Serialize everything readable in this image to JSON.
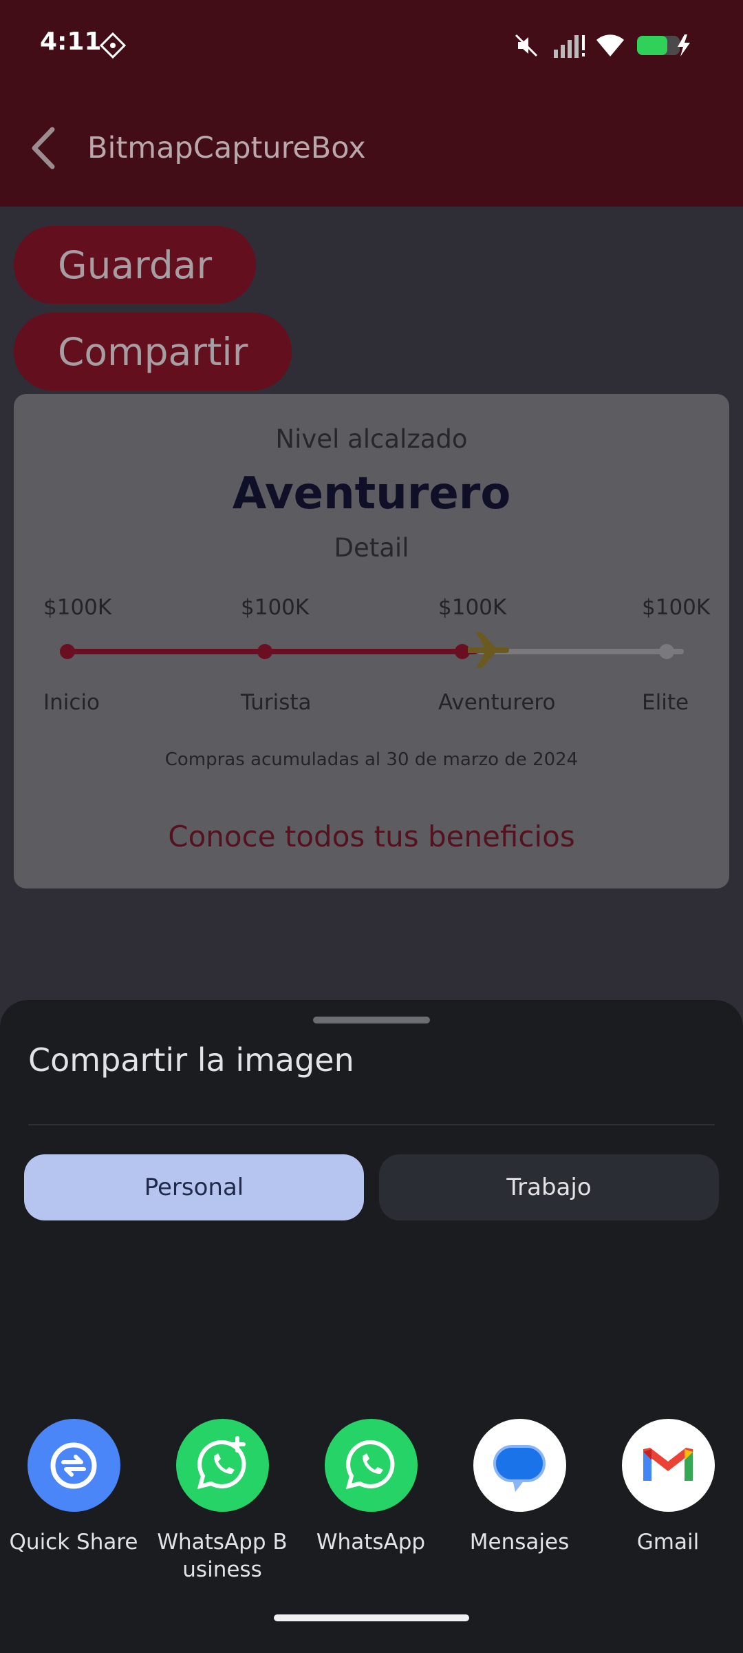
{
  "status_bar": {
    "time": "4:11",
    "icons": [
      "location-diamond-icon",
      "mute-icon",
      "signal-icon",
      "wifi-icon",
      "battery-charging-icon"
    ]
  },
  "app_bar": {
    "back_icon": "back-arrow-icon",
    "title": "BitmapCaptureBox"
  },
  "actions": {
    "guardar": "Guardar",
    "compartir": "Compartir"
  },
  "card": {
    "nivel_label": "Nivel alcalzado",
    "level_name": "Aventurero",
    "detail": "Detail",
    "progress": {
      "amounts": [
        "$100K",
        "$100K",
        "$100K",
        "$100K"
      ],
      "stops": [
        "Inicio",
        "Turista",
        "Aventurero",
        "Elite"
      ],
      "current_stop_index": 2,
      "marker_icon": "airplane-icon",
      "active_color": "#6a0f21",
      "inactive_color": "#7a7a7d",
      "marker_color": "#6b5a1f"
    },
    "compras": "Compras acumuladas al 30 de marzo de 2024",
    "link": "Conoce todos tus beneficios"
  },
  "share_sheet": {
    "title": "Compartir la imagen",
    "tabs": [
      {
        "label": "Personal",
        "selected": true
      },
      {
        "label": "Trabajo",
        "selected": false
      }
    ],
    "apps": [
      {
        "label": "Quick Share",
        "icon": "quick-share-icon",
        "color": "#4a86f7"
      },
      {
        "label": "WhatsApp B\nusiness",
        "icon": "whatsapp-business-icon",
        "color": "#25d366"
      },
      {
        "label": "WhatsApp",
        "icon": "whatsapp-icon",
        "color": "#25d366"
      },
      {
        "label": "Mensajes",
        "icon": "messages-icon",
        "color": "#ffffff"
      },
      {
        "label": "Gmail",
        "icon": "gmail-icon",
        "color": "#ffffff"
      }
    ]
  }
}
